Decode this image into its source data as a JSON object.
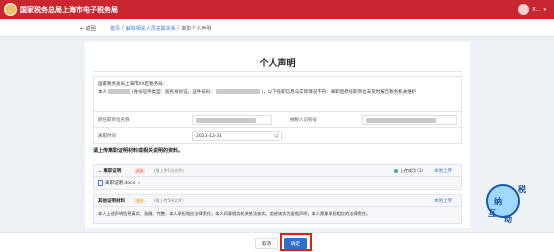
{
  "header": {
    "app_title": "国家税务总局上海市电子税务局",
    "user_text": "X..."
  },
  "nav": {
    "back_label": "返回",
    "crumbs": [
      "首页",
      "解除相关人员关联关系",
      "离职个人声明"
    ],
    "separator": "/"
  },
  "main": {
    "title": "个人声明",
    "decl_line1": "国家税务总局上海市XX区税务局：",
    "decl_prefix": "本人",
    "decl_mid1": "(身份证件类型：居民身份证，证件号码：",
    "decl_mid2": ")，以下任职信息与实际情况不符：离职后原任职单位未及时报告税务机关维护",
    "form": {
      "employer_name_label": "原任职单位名称",
      "taxpayer_id_label": "纳税人识别号",
      "leave_time_label": "离职时间",
      "leave_time_value": "2023-12-31"
    },
    "upload_section_title": "请上传离职证明材料或相关说明的资料。",
    "proof": {
      "name": "离职证明",
      "tag": "必传",
      "hint": "(限上传1份文件)",
      "status": "上传成功 (1)",
      "upload_link": "本地上传",
      "file_name": "离职证明.docx"
    },
    "other": {
      "name": "其他证明材料",
      "tag": "选传",
      "hint": "(限上传5份文件)",
      "upload_link": "本地上传",
      "note": "本人上述声明信息真实、准确、完整，本人承担相应法律责任。本人同意税务机关依法核实，若经核实为虚假声明，本人愿意承担相应的法律责任。"
    }
  },
  "footer": {
    "cancel_label": "取消",
    "confirm_label": "确定"
  },
  "sticker": {
    "chars": [
      "纳",
      "税",
      "互",
      "动"
    ]
  },
  "colors": {
    "brand": "#c8272f",
    "link": "#3a7bd5",
    "primary": "#2f6fd1",
    "success": "#3db27e",
    "highlight": "#e02020"
  }
}
